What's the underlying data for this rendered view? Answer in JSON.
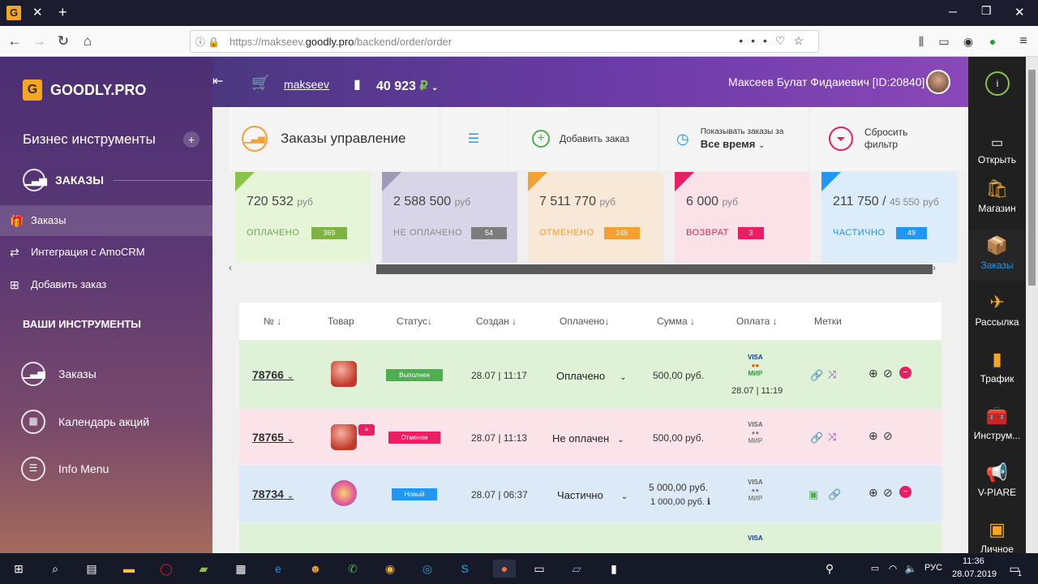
{
  "browser": {
    "url_prefix": "https://makseev.",
    "url_domain": "goodly.pro",
    "url_path": "/backend/order/order"
  },
  "sidebar": {
    "brand": "GOODLY.PRO",
    "heading": "Бизнес инструменты",
    "section": "ЗАКАЗЫ",
    "items": [
      {
        "label": "Заказы"
      },
      {
        "label": "Интеграция с AmoCRM"
      },
      {
        "label": "Добавить заказ"
      }
    ],
    "tools_heading": "ВАШИ ИНСТРУМЕНТЫ",
    "tools": [
      {
        "label": "Заказы"
      },
      {
        "label": "Календарь акций"
      },
      {
        "label": "Info Menu"
      }
    ]
  },
  "topbar": {
    "username": "makseev",
    "balance": "40 923",
    "currency": "₽",
    "user_full": "Максеев Булат Фидаиевич [ID:20840]"
  },
  "toolbar": {
    "title": "Заказы управление",
    "add_order": "Добавить заказ",
    "show_for_label": "Показывать заказы за",
    "show_for_value": "Все время",
    "reset_filter_1": "Сбросить",
    "reset_filter_2": "фильтр"
  },
  "cards": [
    {
      "amount": "720 532",
      "unit": "руб",
      "label": "ОПЛАЧЕНО",
      "count": "369",
      "color": "#8bc34a"
    },
    {
      "amount": "2 588 500",
      "unit": "руб",
      "label": "НЕ ОПЛАЧЕНО",
      "count": "54",
      "color": "#9e9ab8"
    },
    {
      "amount": "7 511 770",
      "unit": "руб",
      "label": "ОТМЕНЕНО",
      "count": "246",
      "color": "#f5a032"
    },
    {
      "amount": "6 000",
      "unit": "руб",
      "label": "ВОЗВРАТ",
      "count": "3",
      "color": "#e91e63"
    },
    {
      "amount": "211 750 /",
      "amount2": "45 550",
      "unit": "руб",
      "label": "ЧАСТИЧНО",
      "count": "49",
      "color": "#2196f3"
    }
  ],
  "table": {
    "headers": [
      "№ ↓",
      "Товар",
      "Статус↓",
      "Создан ↓",
      "Оплачено↓",
      "Сумма ↓",
      "Оплата ↓",
      "Метки"
    ],
    "rows": [
      {
        "id": "78766",
        "status": "Выполнен",
        "created": "28.07 | 11:17",
        "paid": "Оплачено",
        "sum": "500,00 руб.",
        "pay_time": "28.07 | 11:19"
      },
      {
        "id": "78765",
        "status": "Отменен",
        "created": "28.07 | 11:13",
        "paid": "Не оплачен",
        "sum": "500,00 руб."
      },
      {
        "id": "78734",
        "status": "Новый",
        "created": "28.07 | 06:37",
        "paid": "Частично",
        "sum": "5 000,00 руб.",
        "sum2": "1 000,00 руб."
      }
    ],
    "pay_visa": "VISA",
    "pay_mir": "МИР"
  },
  "right_panel": [
    {
      "label": "Открыть"
    },
    {
      "label": "Магазин"
    },
    {
      "label": "Заказы"
    },
    {
      "label": "Рассылка"
    },
    {
      "label": "Трафик"
    },
    {
      "label": "Инструм..."
    },
    {
      "label": "V-PIARE"
    },
    {
      "label": "Личное"
    }
  ],
  "taskbar": {
    "lang": "РУС",
    "time": "11:36",
    "date": "28.07.2019",
    "notif": "1"
  }
}
